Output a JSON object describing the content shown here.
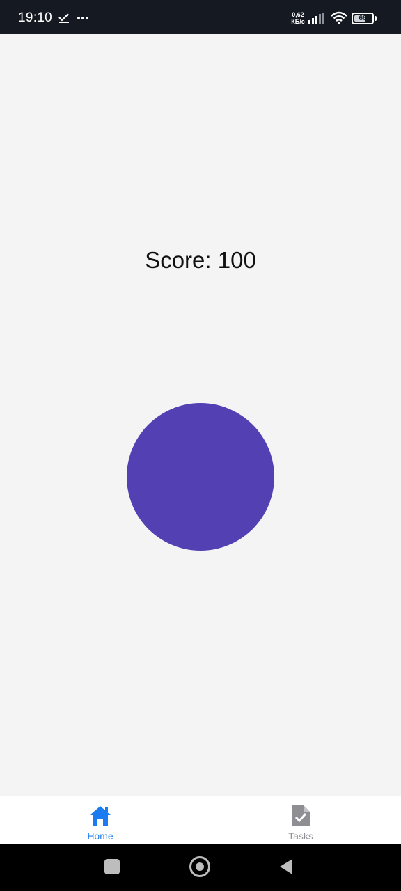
{
  "status_bar": {
    "time": "19:10",
    "net_speed_value": "0,62",
    "net_speed_unit": "КБ/с",
    "battery_level": "68",
    "battery_percent": 68,
    "icons": [
      "check-icon",
      "more-icon",
      "signal-icon",
      "wifi-icon",
      "battery-icon"
    ]
  },
  "game": {
    "score_label": "Score:",
    "score_value": "100",
    "target_color": "#5340b3"
  },
  "tab_bar": {
    "tabs": [
      {
        "label": "Home",
        "icon": "home-icon",
        "active": true
      },
      {
        "label": "Tasks",
        "icon": "task-file-icon",
        "active": false
      }
    ],
    "active_color": "#1a7cf0",
    "inactive_color": "#8e8e93"
  },
  "nav_bar": {
    "buttons": [
      "recents-icon",
      "home-circle-icon",
      "back-icon"
    ]
  }
}
